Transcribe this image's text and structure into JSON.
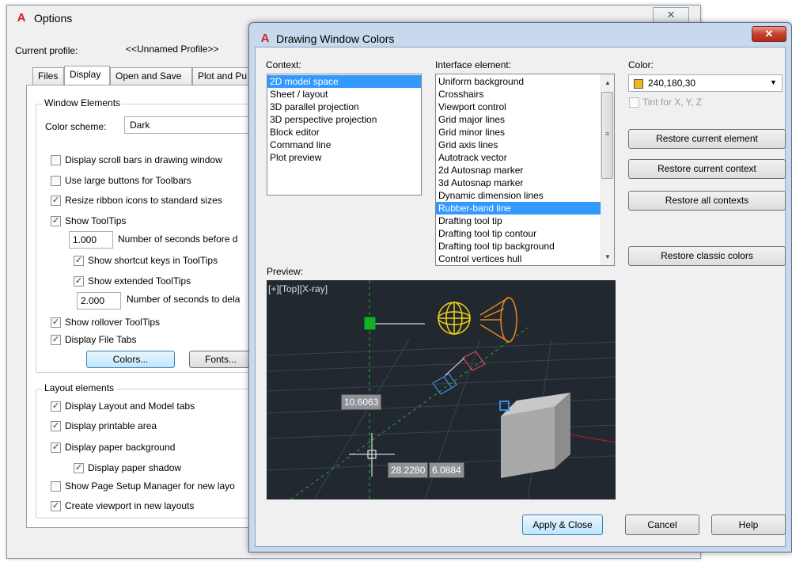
{
  "options": {
    "title": "Options",
    "close_glyph": "✕",
    "current_profile_label": "Current profile:",
    "current_profile_value": "<<Unnamed Profile>>",
    "tabs": [
      "Files",
      "Display",
      "Open and Save",
      "Plot and Pu"
    ],
    "active_tab": "Display",
    "window_elements": {
      "title": "Window Elements",
      "color_scheme_label": "Color scheme:",
      "color_scheme_value": "Dark",
      "display_scroll_bars": "Display scroll bars in drawing window",
      "large_buttons": "Use large buttons for Toolbars",
      "resize_ribbon": "Resize ribbon icons to standard sizes",
      "show_tooltips": "Show ToolTips",
      "tooltip_delay_value": "1.000",
      "tooltip_delay_label": "Number of seconds before d",
      "show_shortcut_keys": "Show shortcut keys in ToolTips",
      "show_extended_tooltips": "Show extended ToolTips",
      "extended_delay_value": "2.000",
      "extended_delay_label": "Number of seconds to dela",
      "show_rollover": "Show rollover ToolTips",
      "display_file_tabs": "Display File Tabs",
      "colors_button": "Colors...",
      "fonts_button": "Fonts..."
    },
    "layout_elements": {
      "title": "Layout elements",
      "display_layout_tabs": "Display Layout and Model tabs",
      "display_printable": "Display printable area",
      "display_paper_bg": "Display paper background",
      "display_paper_shadow": "Display paper shadow",
      "show_page_setup": "Show Page Setup Manager for new layo",
      "create_viewport": "Create viewport in new layouts"
    }
  },
  "dwc": {
    "title": "Drawing Window Colors",
    "close_glyph": "✕",
    "context_label": "Context:",
    "contexts": [
      "2D model space",
      "Sheet / layout",
      "3D parallel projection",
      "3D perspective projection",
      "Block editor",
      "Command line",
      "Plot preview"
    ],
    "selected_context_index": 0,
    "interface_label": "Interface element:",
    "interface_elements": [
      "Uniform background",
      "Crosshairs",
      "Viewport control",
      "Grid major lines",
      "Grid minor lines",
      "Grid axis lines",
      "Autotrack vector",
      "2d Autosnap marker",
      "3d Autosnap marker",
      "Dynamic dimension lines",
      "Rubber-band line",
      "Drafting tool tip",
      "Drafting tool tip contour",
      "Drafting tool tip background",
      "Control vertices hull"
    ],
    "selected_interface_index": 10,
    "color_label": "Color:",
    "color_value": "240,180,30",
    "color_swatch": "#f0b41e",
    "tint_label": "Tint for X, Y, Z",
    "restore_current_element": "Restore current element",
    "restore_current_context": "Restore current context",
    "restore_all_contexts": "Restore all contexts",
    "restore_classic": "Restore classic colors",
    "preview_label": "Preview:",
    "viewport_label": "[+][Top][X-ray]",
    "dim_a": "10.6063",
    "dim_b": "28.2280",
    "dim_c": "6.0884",
    "apply_close": "Apply & Close",
    "cancel": "Cancel",
    "help": "Help"
  }
}
